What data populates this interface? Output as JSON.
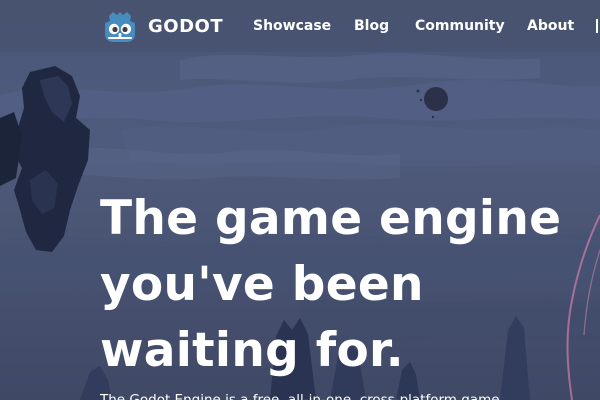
{
  "colors": {
    "background": "#4b5778",
    "navbar": "#47526e",
    "text": "#ffffff",
    "logo_blue": "#478cbf"
  },
  "brand": {
    "name": "GODOT",
    "logo_icon": "godot-robot-icon"
  },
  "nav": {
    "items": [
      {
        "label": "Showcase"
      },
      {
        "label": "Blog"
      },
      {
        "label": "Community"
      },
      {
        "label": "About"
      }
    ]
  },
  "hero": {
    "title_lines": [
      "The game engine",
      "you've been",
      "waiting for."
    ],
    "subtitle": "The Godot Engine is a free, all-in-one, cross-platform game"
  }
}
